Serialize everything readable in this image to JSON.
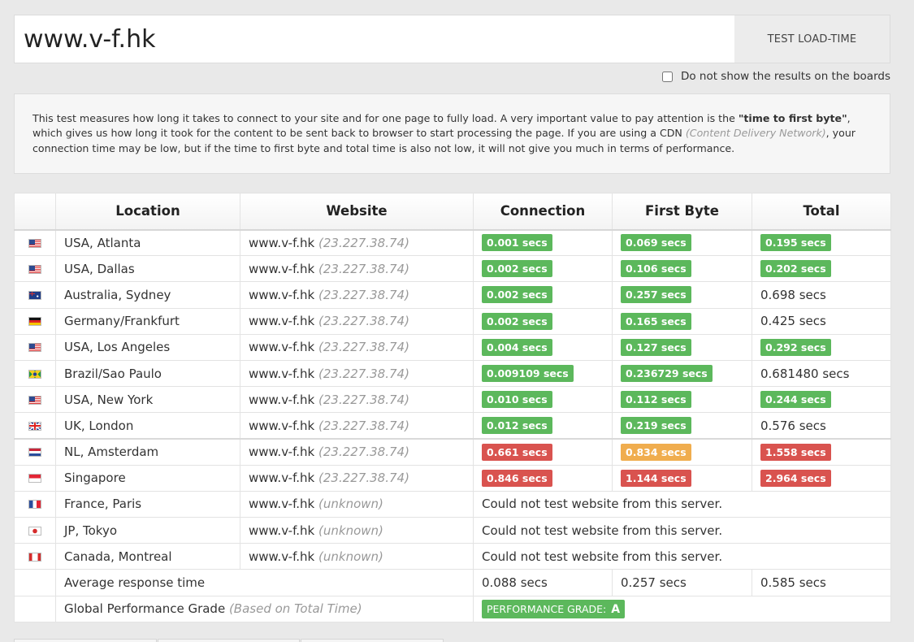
{
  "search": {
    "value": "www.v-f.hk",
    "button_label": "TEST LOAD-TIME"
  },
  "options": {
    "hide_results_label": "Do not show the results on the boards",
    "hide_results_checked": false
  },
  "info": {
    "text_before": "This test measures how long it takes to connect to your site and for one page to fully load. A very important value to pay attention is the ",
    "bold": "\"time to first byte\"",
    "text_middle": ", which gives us how long it took for the content to be sent back to browser to start processing the page. If you are using a CDN ",
    "italic": "(Content Delivery Network)",
    "text_after": ", your connection time may be low, but if the time to first byte and total time is also not low, it will not give you much in terms of performance."
  },
  "table": {
    "headers": {
      "location": "Location",
      "website": "Website",
      "connection": "Connection",
      "first_byte": "First Byte",
      "total": "Total"
    },
    "rows": [
      {
        "flag": "us-flag-icon",
        "location": "USA, Atlanta",
        "site": "www.v-f.hk",
        "ip": "(23.227.38.74)",
        "connection": "0.001 secs",
        "connection_status": "good",
        "first_byte": "0.069 secs",
        "first_byte_status": "good",
        "total": "0.195 secs",
        "total_status": "good"
      },
      {
        "flag": "us-flag-icon",
        "location": "USA, Dallas",
        "site": "www.v-f.hk",
        "ip": "(23.227.38.74)",
        "connection": "0.002 secs",
        "connection_status": "good",
        "first_byte": "0.106 secs",
        "first_byte_status": "good",
        "total": "0.202 secs",
        "total_status": "good"
      },
      {
        "flag": "au-flag-icon",
        "location": "Australia, Sydney",
        "site": "www.v-f.hk",
        "ip": "(23.227.38.74)",
        "connection": "0.002 secs",
        "connection_status": "good",
        "first_byte": "0.257 secs",
        "first_byte_status": "good",
        "total": "0.698 secs",
        "total_status": "plain"
      },
      {
        "flag": "de-flag-icon",
        "location": "Germany/Frankfurt",
        "site": "www.v-f.hk",
        "ip": "(23.227.38.74)",
        "connection": "0.002 secs",
        "connection_status": "good",
        "first_byte": "0.165 secs",
        "first_byte_status": "good",
        "total": "0.425 secs",
        "total_status": "plain"
      },
      {
        "flag": "us-flag-icon",
        "location": "USA, Los Angeles",
        "site": "www.v-f.hk",
        "ip": "(23.227.38.74)",
        "connection": "0.004 secs",
        "connection_status": "good",
        "first_byte": "0.127 secs",
        "first_byte_status": "good",
        "total": "0.292 secs",
        "total_status": "good"
      },
      {
        "flag": "br-flag-icon",
        "location": "Brazil/Sao Paulo",
        "site": "www.v-f.hk",
        "ip": "(23.227.38.74)",
        "connection": "0.009109 secs",
        "connection_status": "good",
        "first_byte": "0.236729 secs",
        "first_byte_status": "good",
        "total": "0.681480 secs",
        "total_status": "plain"
      },
      {
        "flag": "us-flag-icon",
        "location": "USA, New York",
        "site": "www.v-f.hk",
        "ip": "(23.227.38.74)",
        "connection": "0.010 secs",
        "connection_status": "good",
        "first_byte": "0.112 secs",
        "first_byte_status": "good",
        "total": "0.244 secs",
        "total_status": "good"
      },
      {
        "flag": "uk-flag-icon",
        "location": "UK, London",
        "site": "www.v-f.hk",
        "ip": "(23.227.38.74)",
        "connection": "0.012 secs",
        "connection_status": "good",
        "first_byte": "0.219 secs",
        "first_byte_status": "good",
        "total": "0.576 secs",
        "total_status": "plain"
      },
      {
        "flag": "nl-flag-icon",
        "location": "NL, Amsterdam",
        "site": "www.v-f.hk",
        "ip": "(23.227.38.74)",
        "connection": "0.661 secs",
        "connection_status": "bad",
        "first_byte": "0.834 secs",
        "first_byte_status": "warn",
        "total": "1.558 secs",
        "total_status": "bad"
      },
      {
        "flag": "sg-flag-icon",
        "location": "Singapore",
        "site": "www.v-f.hk",
        "ip": "(23.227.38.74)",
        "connection": "0.846 secs",
        "connection_status": "bad",
        "first_byte": "1.144 secs",
        "first_byte_status": "bad",
        "total": "2.964 secs",
        "total_status": "bad"
      },
      {
        "flag": "fr-flag-icon",
        "location": "France, Paris",
        "site": "www.v-f.hk",
        "ip": "(unknown)",
        "error": "Could not test website from this server."
      },
      {
        "flag": "jp-flag-icon",
        "location": "JP, Tokyo",
        "site": "www.v-f.hk",
        "ip": "(unknown)",
        "error": "Could not test website from this server."
      },
      {
        "flag": "ca-flag-icon",
        "location": "Canada, Montreal",
        "site": "www.v-f.hk",
        "ip": "(unknown)",
        "error": "Could not test website from this server."
      }
    ],
    "average": {
      "label": "Average response time",
      "connection": "0.088 secs",
      "first_byte": "0.257 secs",
      "total": "0.585 secs"
    },
    "grade": {
      "label": "Global Performance Grade",
      "note": "(Based on Total Time)",
      "badge_label": "PERFORMANCE GRADE:",
      "badge_value": "A"
    }
  },
  "colors": {
    "good": "#5cb85c",
    "warn": "#f0ad4e",
    "bad": "#d9534f"
  }
}
